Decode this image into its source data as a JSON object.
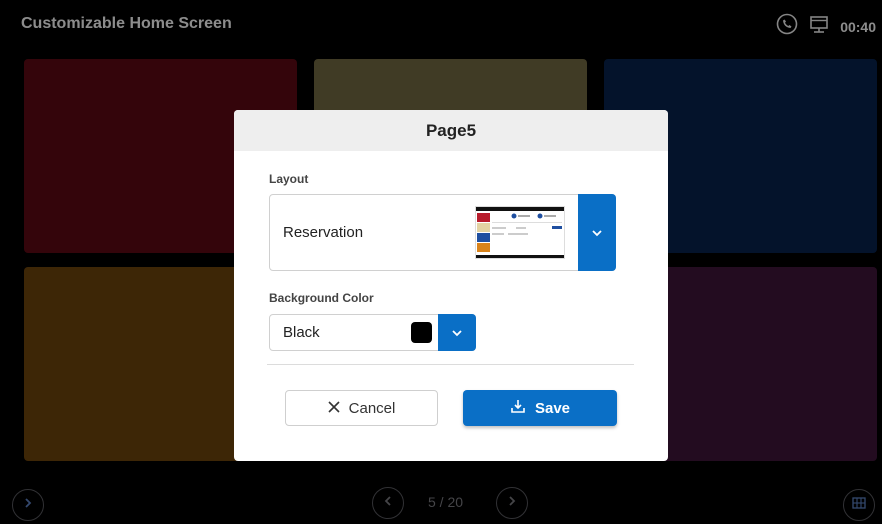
{
  "app": {
    "title": "Customizable Home Screen"
  },
  "status": {
    "time": "00:40",
    "icons": [
      "phone-icon",
      "monitor-icon"
    ]
  },
  "tiles": [
    {
      "color": "#5a0a14"
    },
    {
      "color": "#6f6640"
    },
    {
      "color": "#07224a"
    },
    {
      "color": "#6a420c"
    },
    {
      "color": "#2a2a2a"
    },
    {
      "color": "#3d1638"
    }
  ],
  "dialog": {
    "title": "Page5",
    "layout": {
      "label": "Layout",
      "value": "Reservation"
    },
    "background": {
      "label": "Background Color",
      "value": "Black",
      "swatch": "#000000"
    },
    "cancel_label": "Cancel",
    "save_label": "Save"
  },
  "pager": {
    "text": "5 / 20"
  },
  "colors": {
    "accent": "#0a6fc6"
  }
}
